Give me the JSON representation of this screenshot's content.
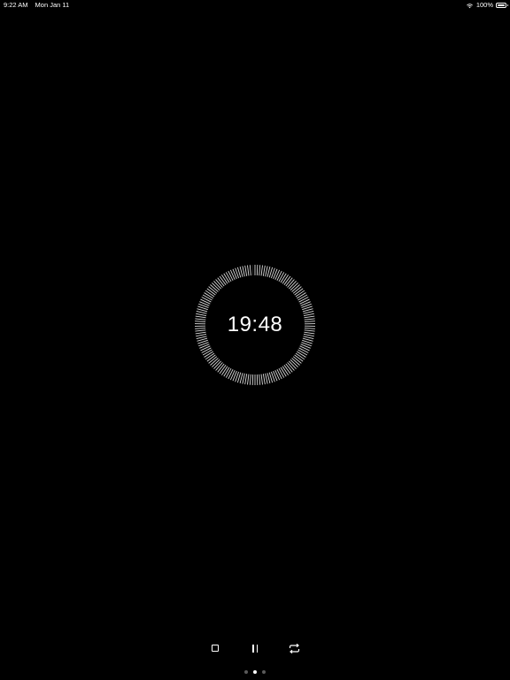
{
  "status_bar": {
    "time": "9:22 AM",
    "date": "Mon Jan 11",
    "battery": "100%",
    "battery_level": 1.0
  },
  "timer": {
    "display": "19:48",
    "progress_remaining": 0.99,
    "ring_color": "#d9d9d9",
    "elapsed_color": "#2a2a2a"
  },
  "controls": [
    {
      "name": "stop-button",
      "icon": "stop-icon"
    },
    {
      "name": "pause-button",
      "icon": "pause-icon"
    },
    {
      "name": "repeat-button",
      "icon": "repeat-icon"
    }
  ],
  "page_indicator": {
    "count": 3,
    "current_index": 1
  }
}
